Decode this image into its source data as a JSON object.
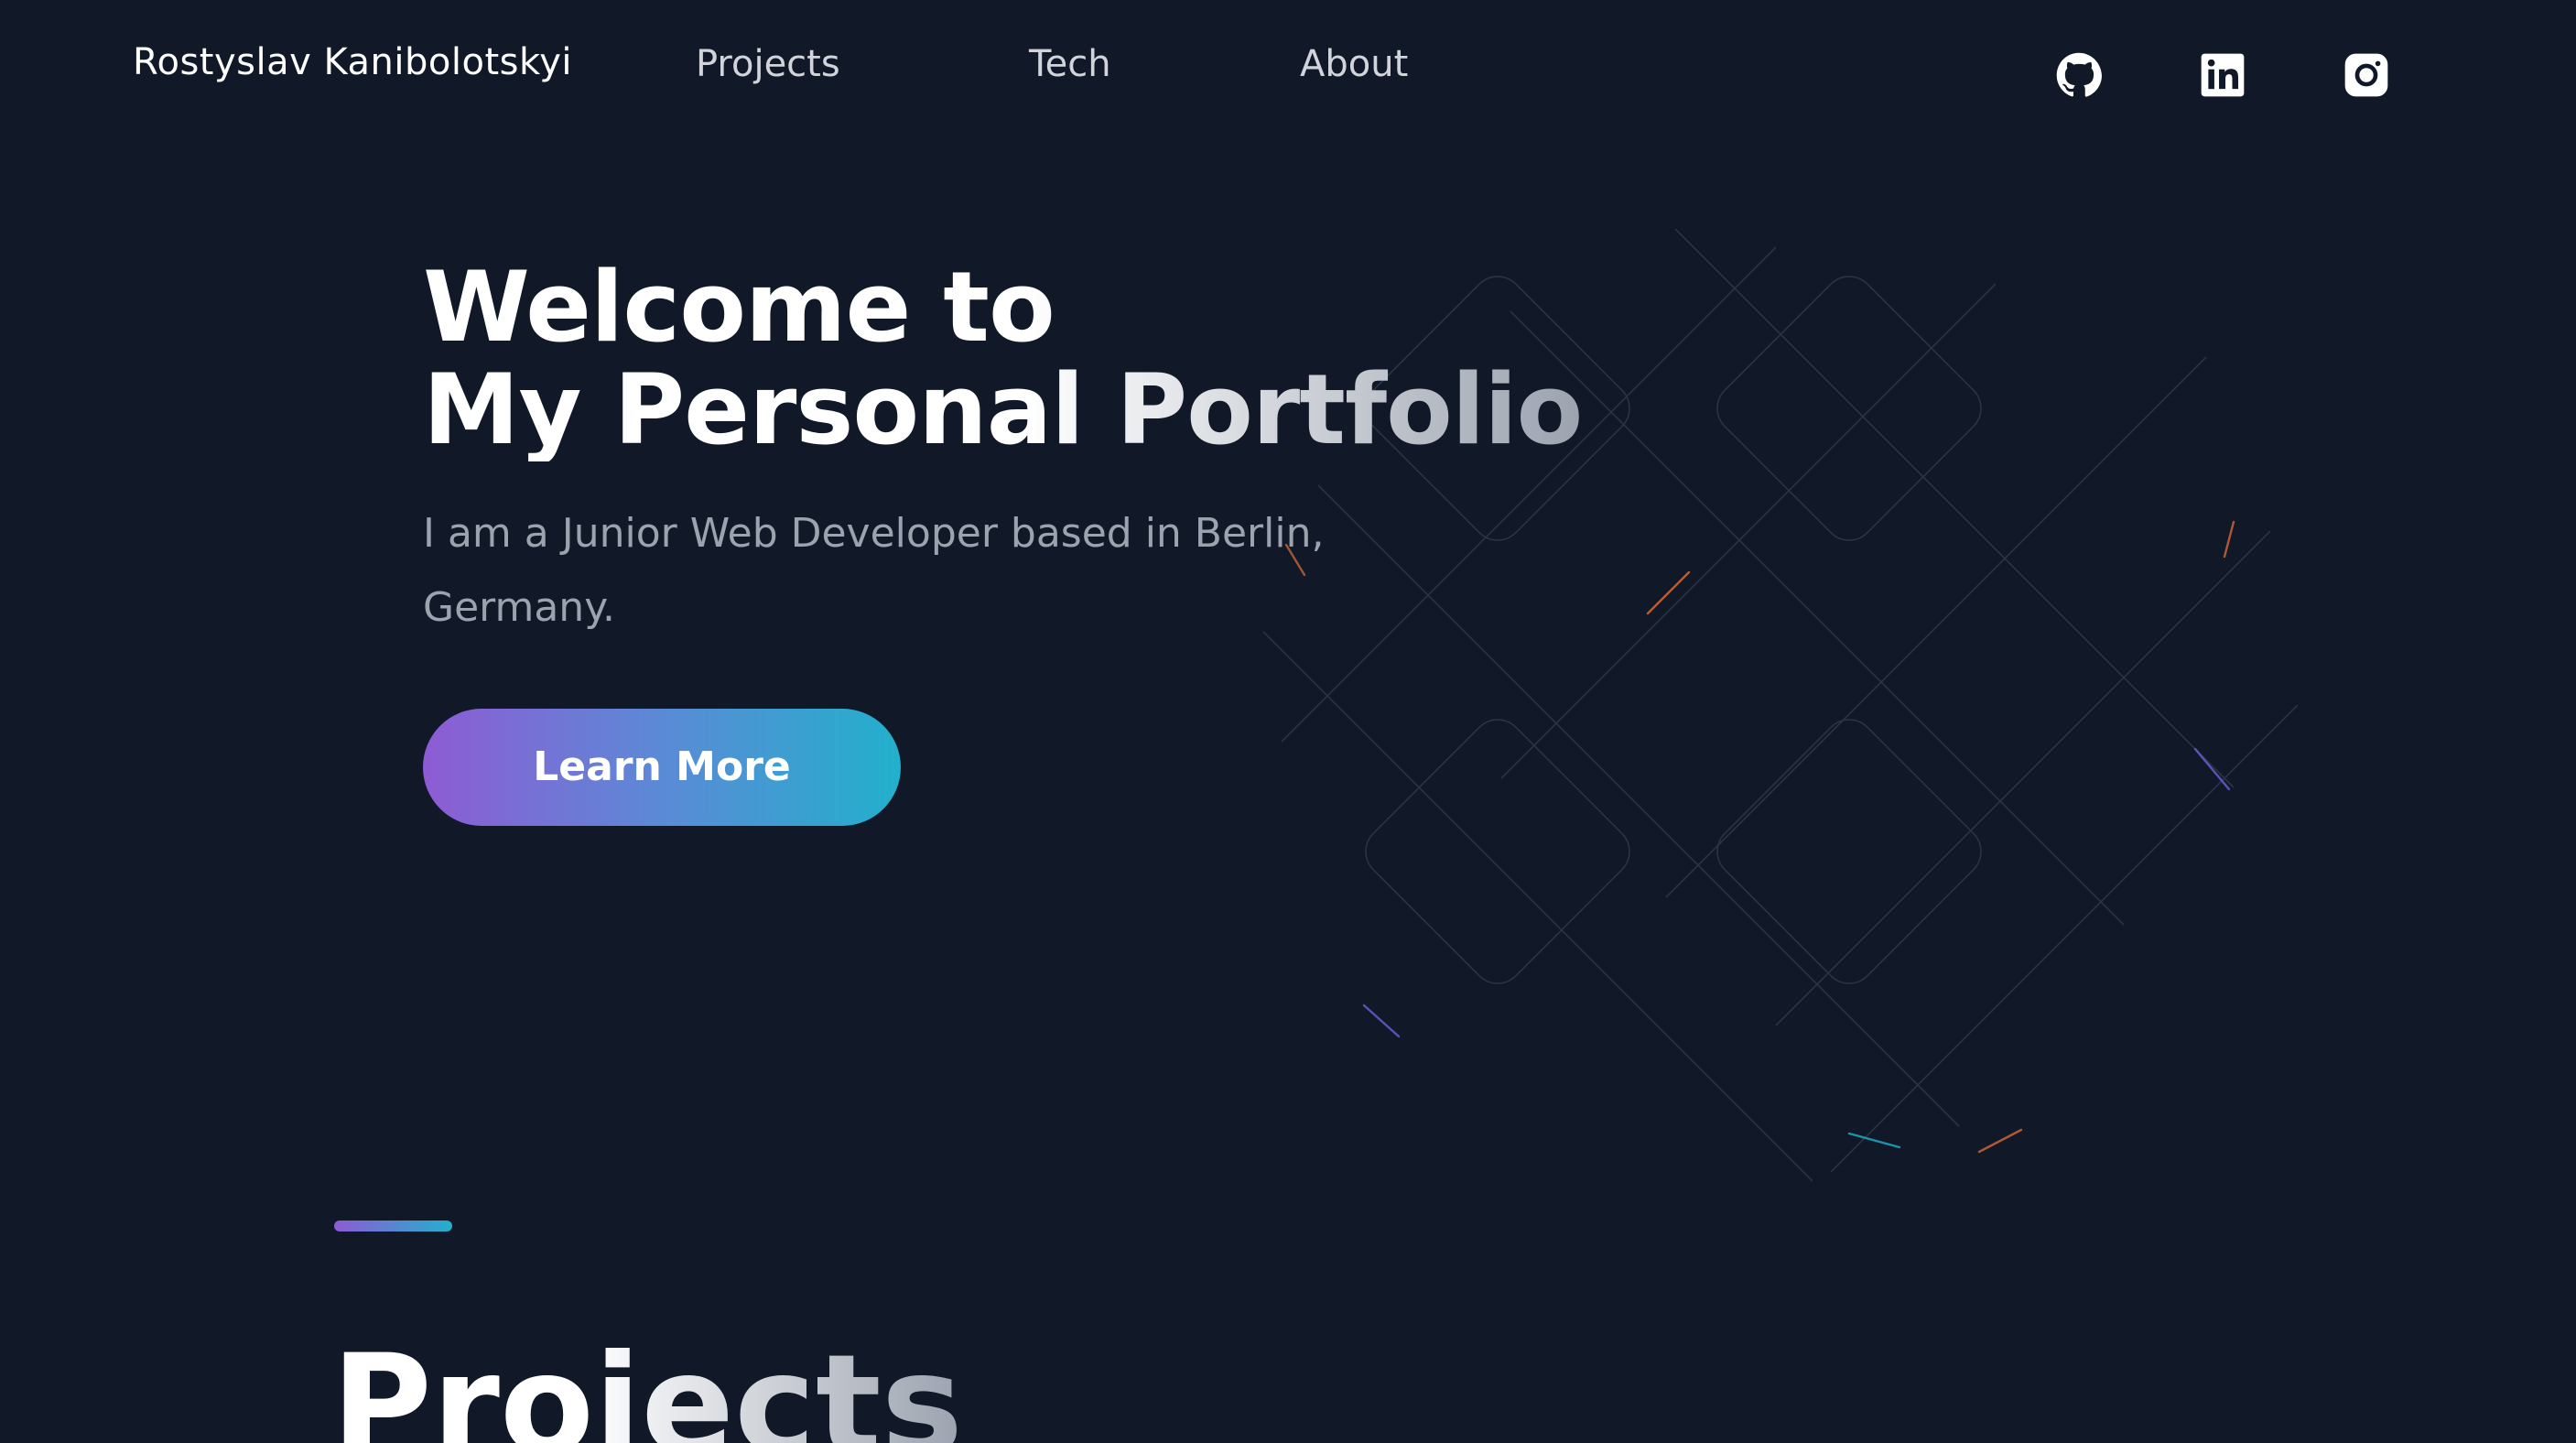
{
  "header": {
    "brand": "Rostyslav Kanibolotskyi",
    "nav": [
      {
        "label": "Projects"
      },
      {
        "label": "Tech"
      },
      {
        "label": "About"
      }
    ],
    "social": [
      {
        "icon": "github-icon"
      },
      {
        "icon": "linkedin-icon"
      },
      {
        "icon": "instagram-icon"
      }
    ]
  },
  "hero": {
    "title_line1": "Welcome to",
    "title_line2": "My Personal Portfolio",
    "subtitle": "I am a Junior Web Developer based in Berlin, Germany.",
    "cta_label": "Learn More"
  },
  "projects_section": {
    "title": "Projects"
  },
  "colors": {
    "background": "#111827",
    "gradient_start": "#8e5bd4",
    "gradient_end": "#22b0cc",
    "muted_text": "#9ca3af"
  }
}
